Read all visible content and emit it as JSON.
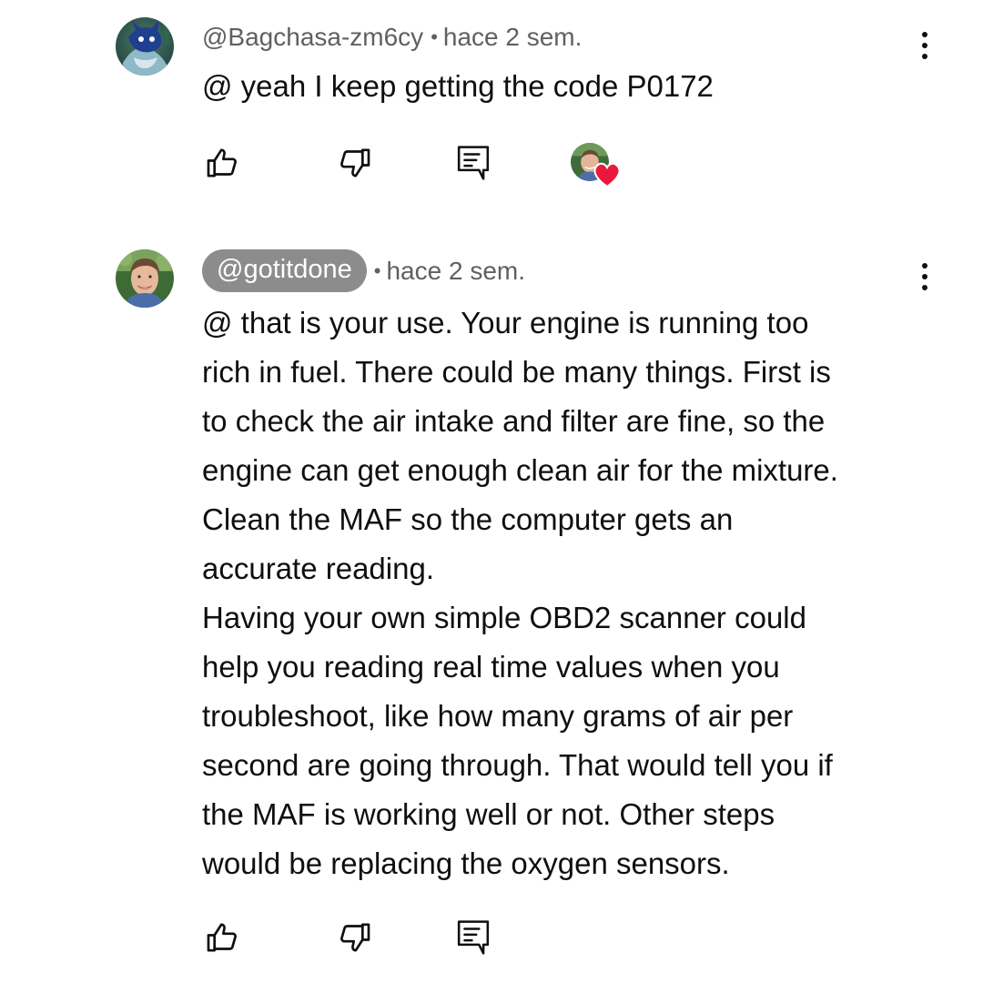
{
  "comments": [
    {
      "author": "@Bagchasa-zm6cy",
      "separator": "•",
      "time": "hace 2 sem.",
      "text": "@ yeah I keep getting the code P0172",
      "hearted_by_creator": true,
      "avatar_icon": "blue-character-avatar"
    },
    {
      "author": "@gotitdone",
      "separator": "•",
      "time": "hace 2 sem.",
      "text": "@ that is your use. Your engine is running too\nrich in fuel. There could be many things. First is\nto check the air intake and filter are fine, so the\nengine can get enough clean air for the mixture.\nClean the MAF so the computer gets an\naccurate reading.\nHaving your own simple OBD2 scanner could\nhelp you reading real time values when you\ntroubleshoot, like how many grams of air per\nsecond are going through. That would tell you if\nthe MAF is working well or not. Other steps\nwould be replacing the oxygen sensors.",
      "author_is_creator": true,
      "avatar_icon": "man-portrait-avatar"
    }
  ],
  "icons": {
    "like": "thumbs-up-icon",
    "dislike": "thumbs-down-icon",
    "reply": "reply-comment-icon",
    "menu": "more-vertical-icon",
    "heart": "heart-icon"
  },
  "colors": {
    "text": "#0f0f0f",
    "meta": "#606060",
    "creator_pill": "#8c8c8c",
    "heart": "#e8193c"
  }
}
